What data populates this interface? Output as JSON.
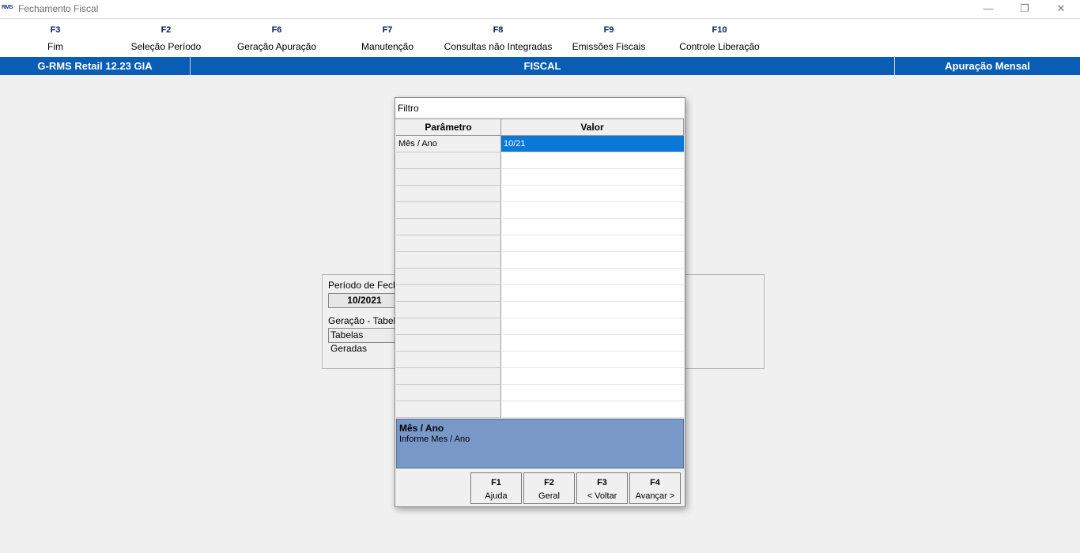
{
  "window": {
    "logo_text": "RMS",
    "title": "Fechamento Fiscal",
    "controls": {
      "minimize": "—",
      "restore": "❐",
      "close": "✕"
    }
  },
  "fkeys": [
    {
      "key": "F3",
      "label": "Fim"
    },
    {
      "key": "F2",
      "label": "Seleção Período"
    },
    {
      "key": "F6",
      "label": "Geração Apuração"
    },
    {
      "key": "F7",
      "label": "Manutenção"
    },
    {
      "key": "F8",
      "label": "Consultas não Integradas"
    },
    {
      "key": "F9",
      "label": "Emissões Fiscais"
    },
    {
      "key": "F10",
      "label": "Controle Liberação"
    }
  ],
  "header": {
    "left": "G-RMS Retail 12.23 GIA",
    "center": "FISCAL",
    "right": "Apuração Mensal",
    "color": "#0a5db5"
  },
  "background_panel": {
    "period_label": "Período de Fecha",
    "period_value": "10/2021",
    "generation_label": "Geração - Tabela",
    "generation_value": "Tabelas Geradas"
  },
  "dialog": {
    "title": "Filtro",
    "grid": {
      "col_param": "Parâmetro",
      "col_value": "Valor",
      "rows": [
        {
          "param": "Mês / Ano",
          "value": "10/21",
          "selected": true
        }
      ]
    },
    "info": {
      "title": "Mês / Ano",
      "text": "Informe Mes / Ano",
      "color": "#7898c8"
    },
    "buttons": [
      {
        "key": "F1",
        "label": "Ajuda"
      },
      {
        "key": "F2",
        "label": "Geral"
      },
      {
        "key": "F3",
        "label": "< Voltar"
      },
      {
        "key": "F4",
        "label": "Avançar >"
      }
    ]
  }
}
